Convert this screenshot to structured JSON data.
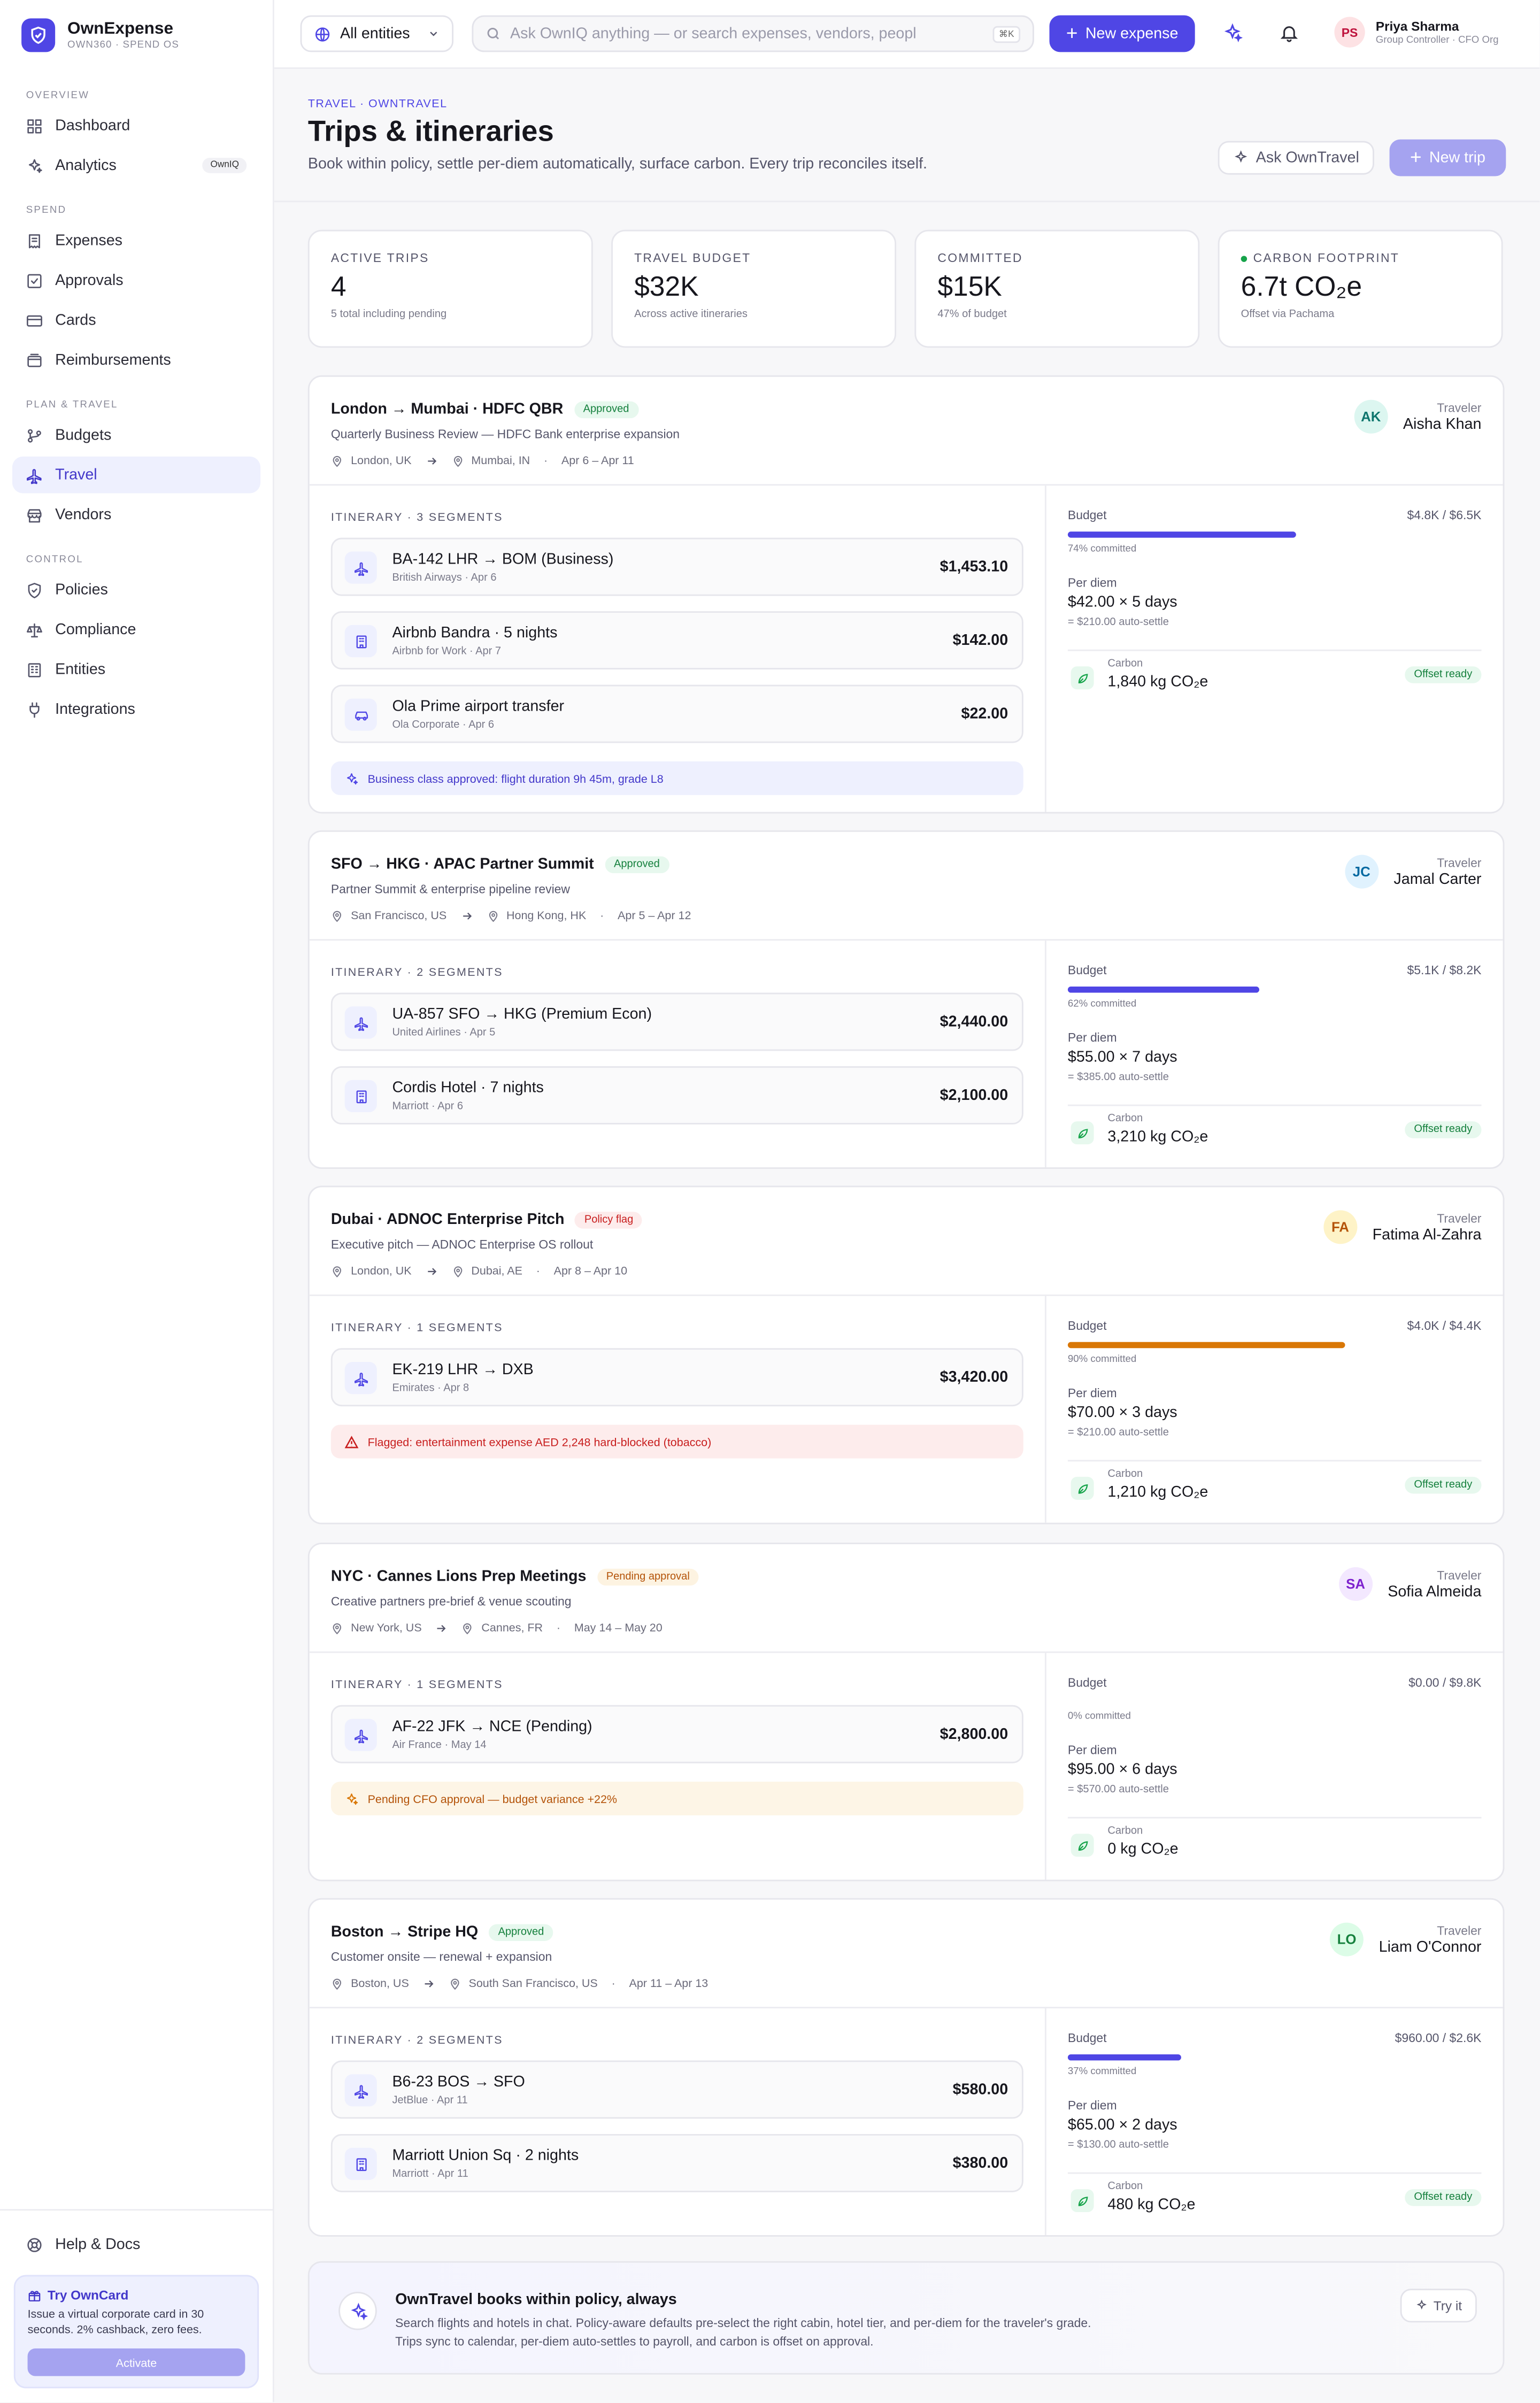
{
  "brand": {
    "name": "OwnExpense",
    "sub": "OWN360 · SPEND OS"
  },
  "sidebar": {
    "sections": [
      {
        "label": "OVERVIEW",
        "items": [
          {
            "label": "Dashboard",
            "icon": "grid-icon"
          },
          {
            "label": "Analytics",
            "icon": "sparkle-icon",
            "badge": "OwnIQ"
          }
        ]
      },
      {
        "label": "SPEND",
        "items": [
          {
            "label": "Expenses",
            "icon": "receipt-icon"
          },
          {
            "label": "Approvals",
            "icon": "check-square-icon"
          },
          {
            "label": "Cards",
            "icon": "card-icon"
          },
          {
            "label": "Reimbursements",
            "icon": "wallet-icon"
          }
        ]
      },
      {
        "label": "PLAN & TRAVEL",
        "items": [
          {
            "label": "Budgets",
            "icon": "branch-icon"
          },
          {
            "label": "Travel",
            "icon": "plane-icon",
            "active": true
          },
          {
            "label": "Vendors",
            "icon": "store-icon"
          }
        ]
      },
      {
        "label": "CONTROL",
        "items": [
          {
            "label": "Policies",
            "icon": "shield-icon"
          },
          {
            "label": "Compliance",
            "icon": "scale-icon"
          },
          {
            "label": "Entities",
            "icon": "building-icon"
          },
          {
            "label": "Integrations",
            "icon": "plug-icon"
          }
        ]
      }
    ],
    "help": "Help & Docs",
    "promo": {
      "title": "Try OwnCard",
      "text": "Issue a virtual corporate card in 30 seconds. 2% cashback, zero fees.",
      "button": "Activate"
    }
  },
  "topbar": {
    "entity": "All entities",
    "search_placeholder": "Ask OwnIQ anything — or search expenses, vendors, peopl",
    "kbd": "⌘K",
    "new_expense": "New expense",
    "user": {
      "initials": "PS",
      "name": "Priya Sharma",
      "role": "Group Controller · CFO Org"
    }
  },
  "header": {
    "crumb": "TRAVEL · OWNTRAVEL",
    "title": "Trips & itineraries",
    "subtitle": "Book within policy, settle per-diem automatically, surface carbon. Every trip reconciles itself.",
    "ask": "Ask OwnTravel",
    "new_trip": "New trip"
  },
  "stats": [
    {
      "label": "ACTIVE TRIPS",
      "value": "4",
      "sub": "5 total including pending"
    },
    {
      "label": "TRAVEL BUDGET",
      "value": "$32K",
      "sub": "Across active itineraries"
    },
    {
      "label": "COMMITTED",
      "value": "$15K",
      "sub": "47% of budget"
    },
    {
      "label": "CARBON FOOTPRINT",
      "value": "6.7t CO₂e",
      "sub": "Offset via Pachama"
    }
  ],
  "trips": [
    {
      "title": "London → Mumbai · HDFC QBR",
      "status": "Approved",
      "status_kind": "green",
      "purpose": "Quarterly Business Review — HDFC Bank enterprise expansion",
      "from": "London, UK",
      "to": "Mumbai, IN",
      "dates": "Apr 6 – Apr 11",
      "traveler_label": "Traveler",
      "traveler": "Aisha Khan",
      "initials": "AK",
      "avatar_bg": "#dcf6f0",
      "avatar_fg": "#0f766e",
      "itinerary_label": "ITINERARY · 3 SEGMENTS",
      "segments": [
        {
          "icon": "plane-icon",
          "name": "BA-142 LHR → BOM (Business)",
          "sub": "British Airways · Apr 6",
          "amount": "$1,453.10"
        },
        {
          "icon": "hotel-icon",
          "name": "Airbnb Bandra · 5 nights",
          "sub": "Airbnb for Work · Apr 7",
          "amount": "$142.00"
        },
        {
          "icon": "car-icon",
          "name": "Ola Prime airport transfer",
          "sub": "Ola Corporate · Apr 6",
          "amount": "$22.00"
        }
      ],
      "note": "Business class approved: flight duration 9h 45m, grade L8",
      "note_kind": "blue",
      "budget_label": "Budget",
      "budget": "$4.8K / $6.5K",
      "committed_pct": 74,
      "committed": "74% committed",
      "bar_color": "#4f46e5",
      "perdiem_label": "Per diem",
      "perdiem": "$42.00 × 5 days",
      "perdiem_sub": "= $210.00 auto-settle",
      "carbon_label": "Carbon",
      "carbon": "1,840 kg CO₂e",
      "offset": "Offset ready"
    },
    {
      "title": "SFO → HKG · APAC Partner Summit",
      "status": "Approved",
      "status_kind": "green",
      "purpose": "Partner Summit & enterprise pipeline review",
      "from": "San Francisco, US",
      "to": "Hong Kong, HK",
      "dates": "Apr 5 – Apr 12",
      "traveler_label": "Traveler",
      "traveler": "Jamal Carter",
      "initials": "JC",
      "avatar_bg": "#e0f2fe",
      "avatar_fg": "#0369a1",
      "itinerary_label": "ITINERARY · 2 SEGMENTS",
      "segments": [
        {
          "icon": "plane-icon",
          "name": "UA-857 SFO → HKG (Premium Econ)",
          "sub": "United Airlines · Apr 5",
          "amount": "$2,440.00"
        },
        {
          "icon": "hotel-icon",
          "name": "Cordis Hotel · 7 nights",
          "sub": "Marriott · Apr 6",
          "amount": "$2,100.00"
        }
      ],
      "note": "",
      "note_kind": "",
      "budget_label": "Budget",
      "budget": "$5.1K / $8.2K",
      "committed_pct": 62,
      "committed": "62% committed",
      "bar_color": "#4f46e5",
      "perdiem_label": "Per diem",
      "perdiem": "$55.00 × 7 days",
      "perdiem_sub": "= $385.00 auto-settle",
      "carbon_label": "Carbon",
      "carbon": "3,210 kg CO₂e",
      "offset": "Offset ready"
    },
    {
      "title": "Dubai · ADNOC Enterprise Pitch",
      "status": "Policy flag",
      "status_kind": "red",
      "purpose": "Executive pitch — ADNOC Enterprise OS rollout",
      "from": "London, UK",
      "to": "Dubai, AE",
      "dates": "Apr 8 – Apr 10",
      "traveler_label": "Traveler",
      "traveler": "Fatima Al-Zahra",
      "initials": "FA",
      "avatar_bg": "#fef3c7",
      "avatar_fg": "#b45309",
      "itinerary_label": "ITINERARY · 1 SEGMENTS",
      "segments": [
        {
          "icon": "plane-icon",
          "name": "EK-219 LHR → DXB",
          "sub": "Emirates · Apr 8",
          "amount": "$3,420.00"
        }
      ],
      "note": "Flagged: entertainment expense AED 2,248 hard-blocked (tobacco)",
      "note_kind": "red",
      "budget_label": "Budget",
      "budget": "$4.0K / $4.4K",
      "committed_pct": 90,
      "committed": "90% committed",
      "bar_color": "#d97706",
      "perdiem_label": "Per diem",
      "perdiem": "$70.00 × 3 days",
      "perdiem_sub": "= $210.00 auto-settle",
      "carbon_label": "Carbon",
      "carbon": "1,210 kg CO₂e",
      "offset": "Offset ready"
    },
    {
      "title": "NYC · Cannes Lions Prep Meetings",
      "status": "Pending approval",
      "status_kind": "amber",
      "purpose": "Creative partners pre-brief & venue scouting",
      "from": "New York, US",
      "to": "Cannes, FR",
      "dates": "May 14 – May 20",
      "traveler_label": "Traveler",
      "traveler": "Sofia Almeida",
      "initials": "SA",
      "avatar_bg": "#f3e8ff",
      "avatar_fg": "#7e22ce",
      "itinerary_label": "ITINERARY · 1 SEGMENTS",
      "segments": [
        {
          "icon": "plane-icon",
          "name": "AF-22 JFK → NCE (Pending)",
          "sub": "Air France · May 14",
          "amount": "$2,800.00"
        }
      ],
      "note": "Pending CFO approval — budget variance +22%",
      "note_kind": "amber",
      "budget_label": "Budget",
      "budget": "$0.00 / $9.8K",
      "committed_pct": 0,
      "committed": "0% committed",
      "bar_color": "#4f46e5",
      "perdiem_label": "Per diem",
      "perdiem": "$95.00 × 6 days",
      "perdiem_sub": "= $570.00 auto-settle",
      "carbon_label": "Carbon",
      "carbon": "0 kg CO₂e",
      "offset": ""
    },
    {
      "title": "Boston → Stripe HQ",
      "status": "Approved",
      "status_kind": "green",
      "purpose": "Customer onsite — renewal + expansion",
      "from": "Boston, US",
      "to": "South San Francisco, US",
      "dates": "Apr 11 – Apr 13",
      "traveler_label": "Traveler",
      "traveler": "Liam O'Connor",
      "initials": "LO",
      "avatar_bg": "#dcfce7",
      "avatar_fg": "#15803d",
      "itinerary_label": "ITINERARY · 2 SEGMENTS",
      "segments": [
        {
          "icon": "plane-icon",
          "name": "B6-23 BOS → SFO",
          "sub": "JetBlue · Apr 11",
          "amount": "$580.00"
        },
        {
          "icon": "hotel-icon",
          "name": "Marriott Union Sq · 2 nights",
          "sub": "Marriott · Apr 11",
          "amount": "$380.00"
        }
      ],
      "note": "",
      "note_kind": "",
      "budget_label": "Budget",
      "budget": "$960.00 / $2.6K",
      "committed_pct": 37,
      "committed": "37% committed",
      "bar_color": "#4f46e5",
      "perdiem_label": "Per diem",
      "perdiem": "$65.00 × 2 days",
      "perdiem_sub": "= $130.00 auto-settle",
      "carbon_label": "Carbon",
      "carbon": "480 kg CO₂e",
      "offset": "Offset ready"
    }
  ],
  "cta": {
    "title": "OwnTravel books within policy, always",
    "text": "Search flights and hotels in chat. Policy-aware defaults pre-select the right cabin, hotel tier, and per-diem for the traveler's grade. Trips sync to calendar, per-diem auto-settles to payroll, and carbon is offset on approval.",
    "button": "Try it"
  }
}
